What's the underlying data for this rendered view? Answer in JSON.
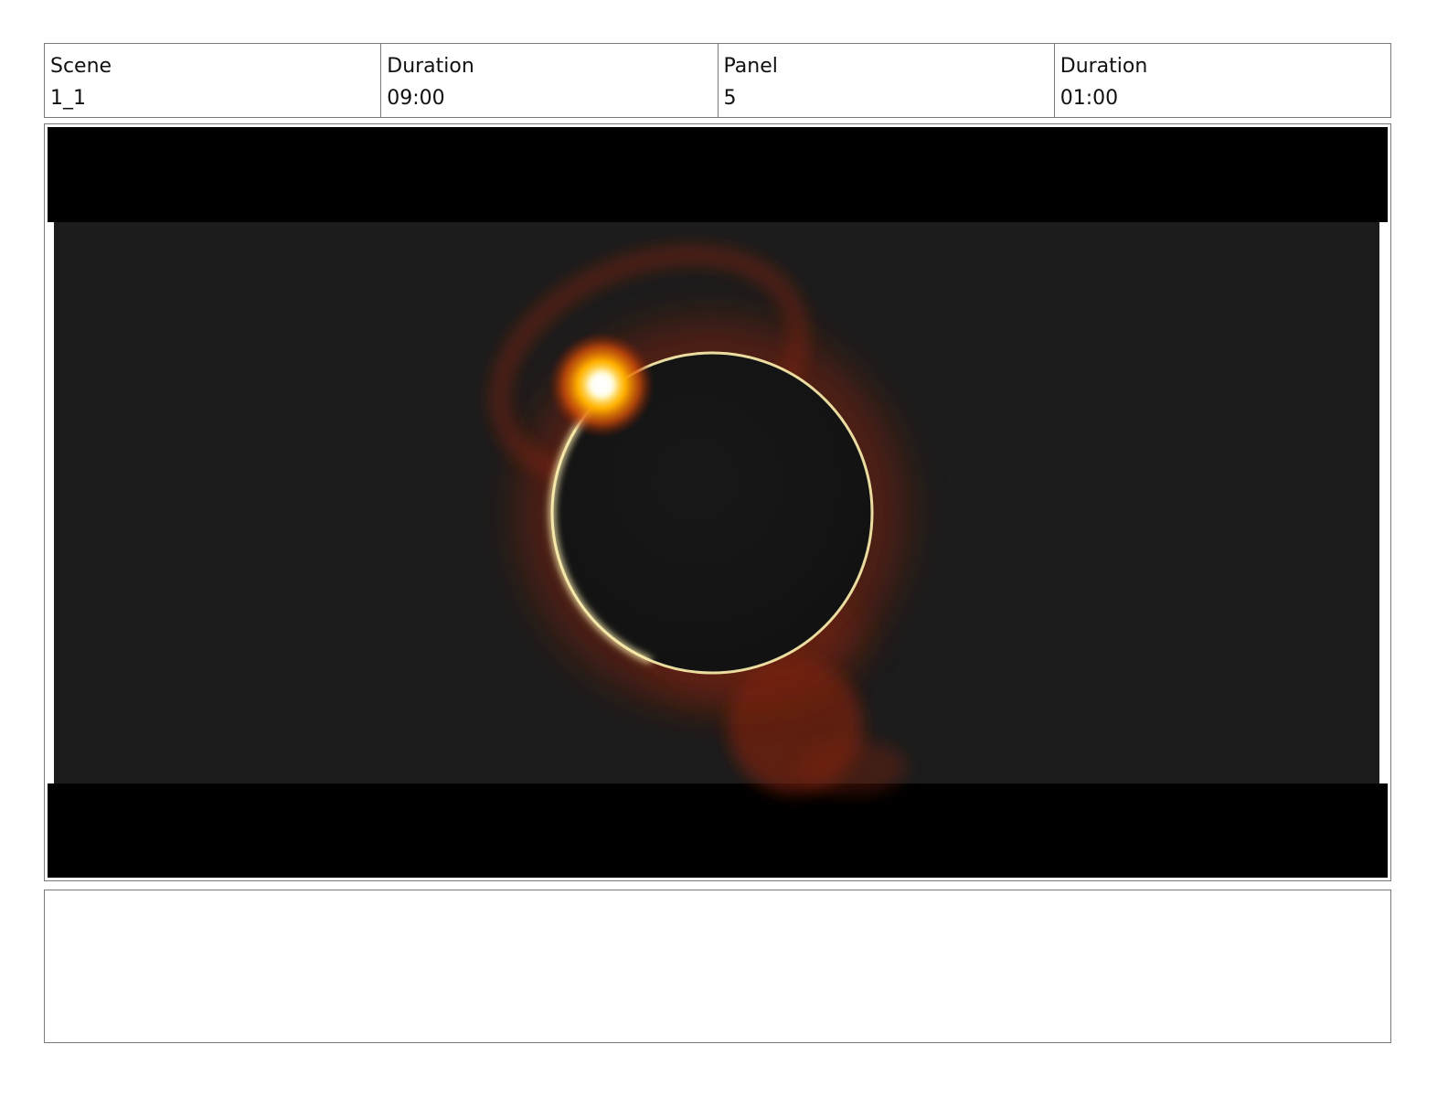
{
  "header": {
    "scene_label": "Scene",
    "scene_value": "1_1",
    "scene_duration_label": "Duration",
    "scene_duration_value": "09:00",
    "panel_label": "Panel",
    "panel_value": "5",
    "panel_duration_label": "Duration",
    "panel_duration_value": "01:00"
  },
  "panel": {
    "description": "",
    "colors": {
      "letterbox": "#000000",
      "sky": "#1c1c1c",
      "moon": "#151515",
      "corona": "#7a2210",
      "ring": "#fff2b0",
      "flare": "#ffb000"
    }
  },
  "notes": {
    "text": ""
  }
}
